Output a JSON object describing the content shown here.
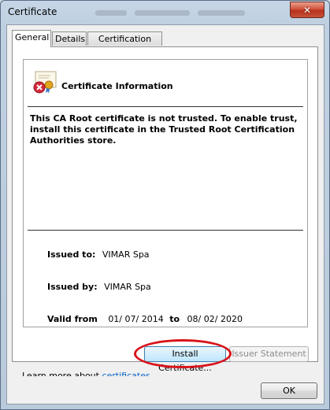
{
  "window": {
    "title": "Certificate",
    "close_glyph": "✕"
  },
  "tabs": [
    {
      "label": "General",
      "active": true
    },
    {
      "label": "Details",
      "active": false
    },
    {
      "label": "Certification Path",
      "active": false
    }
  ],
  "info": {
    "icon": "certificate-error-icon",
    "heading": "Certificate Information",
    "warning": "This CA Root certificate is not trusted. To enable trust, install this certificate in the Trusted Root Certification Authorities store.",
    "issued_to_label": "Issued to:",
    "issued_to_value": "VIMAR Spa",
    "issued_by_label": "Issued by:",
    "issued_by_value": "VIMAR Spa",
    "valid_from_label": "Valid from",
    "valid_from_value": "01/ 07/ 2014",
    "valid_to_label": "to",
    "valid_to_value": "08/ 02/ 2020"
  },
  "buttons": {
    "install": "Install Certificate...",
    "issuer_statement": "Issuer Statement",
    "ok": "OK"
  },
  "footer": {
    "learn_more_prefix": "Learn more about",
    "learn_more_link": "certificates"
  },
  "colors": {
    "highlight_oval": "#d9131a",
    "link": "#0a64c8"
  }
}
